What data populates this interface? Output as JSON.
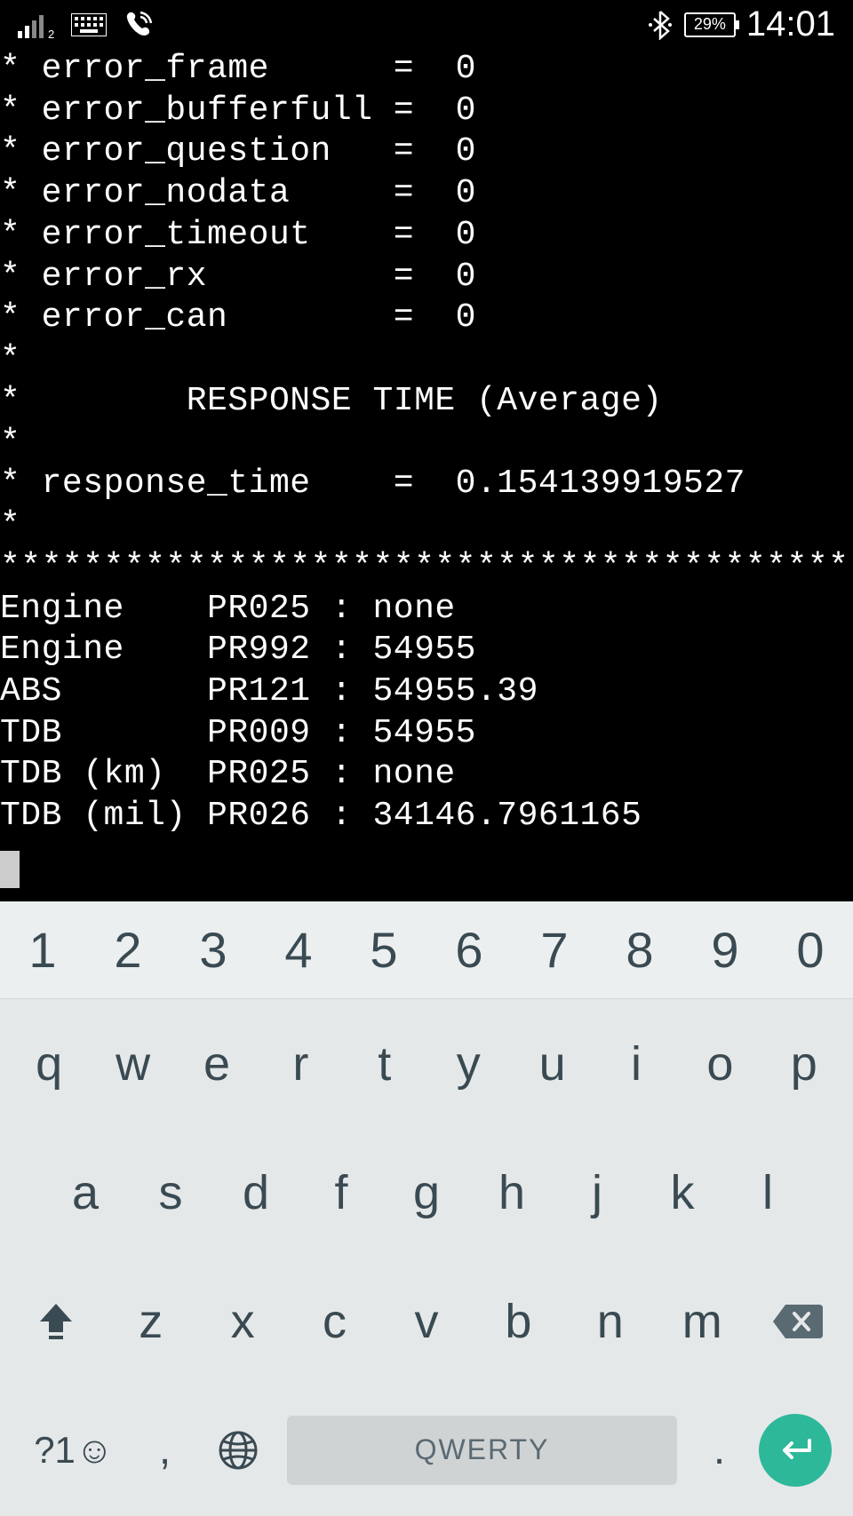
{
  "status_bar": {
    "battery_percent": "29%",
    "time": "14:01"
  },
  "terminal": {
    "errors": [
      {
        "key": "error_frame",
        "val": "0"
      },
      {
        "key": "error_bufferfull",
        "val": "0"
      },
      {
        "key": "error_question",
        "val": "0"
      },
      {
        "key": "error_nodata",
        "val": "0"
      },
      {
        "key": "error_timeout",
        "val": "0"
      },
      {
        "key": "error_rx",
        "val": "0"
      },
      {
        "key": "error_can",
        "val": "0"
      }
    ],
    "section_title": "RESPONSE TIME (Average)",
    "response_time_key": "response_time",
    "response_time_val": "0.154139919527",
    "separator": "*********************************************",
    "readings": [
      {
        "module": "Engine",
        "code": "PR025",
        "val": "none"
      },
      {
        "module": "Engine",
        "code": "PR992",
        "val": "54955"
      },
      {
        "module": "ABS",
        "code": "PR121",
        "val": "54955.39"
      },
      {
        "module": "TDB",
        "code": "PR009",
        "val": "54955"
      },
      {
        "module": "TDB (km)",
        "code": "PR025",
        "val": "none"
      },
      {
        "module": "TDB (mil)",
        "code": "PR026",
        "val": "34146.7961165"
      }
    ]
  },
  "keyboard": {
    "numbers": [
      "1",
      "2",
      "3",
      "4",
      "5",
      "6",
      "7",
      "8",
      "9",
      "0"
    ],
    "row1": [
      "q",
      "w",
      "e",
      "r",
      "t",
      "y",
      "u",
      "i",
      "o",
      "p"
    ],
    "row2": [
      "a",
      "s",
      "d",
      "f",
      "g",
      "h",
      "j",
      "k",
      "l"
    ],
    "row3": [
      "z",
      "x",
      "c",
      "v",
      "b",
      "n",
      "m"
    ],
    "sym": "?1☺",
    "comma": ",",
    "period": ".",
    "space_label": "QWERTY"
  }
}
